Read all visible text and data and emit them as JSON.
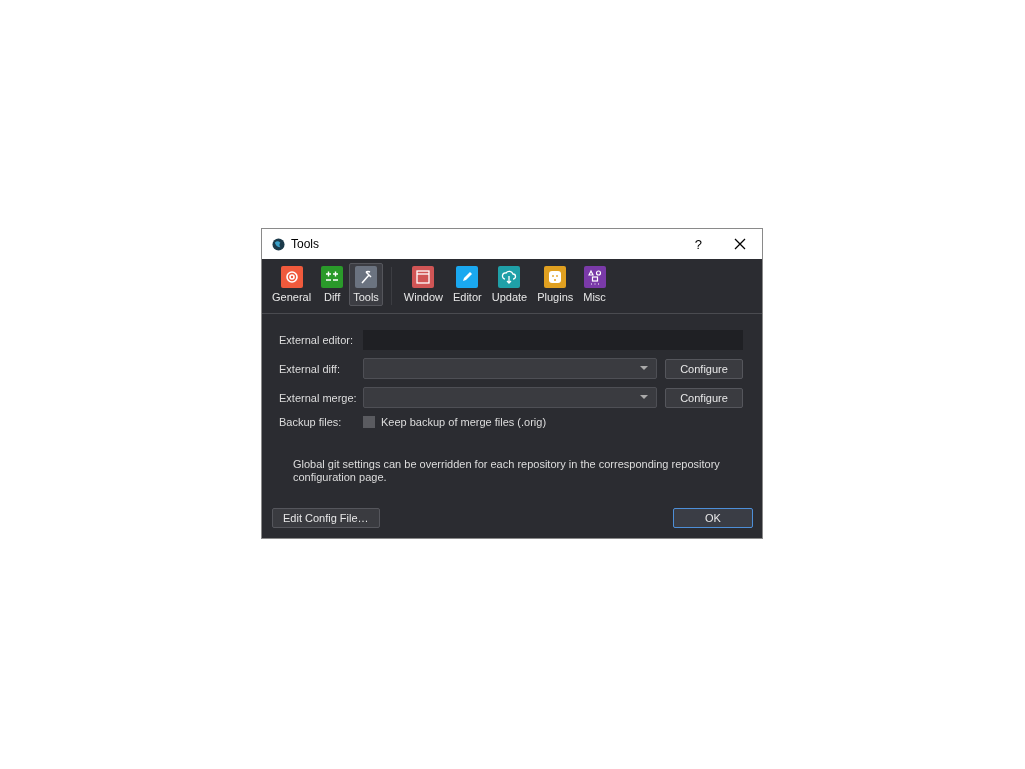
{
  "window": {
    "title": "Tools",
    "help": "?"
  },
  "tabs": [
    {
      "label": "General",
      "kind": "general",
      "color": "#f05a3c",
      "selected": false
    },
    {
      "label": "Diff",
      "kind": "diff",
      "color": "#2a9a2a",
      "selected": false
    },
    {
      "label": "Tools",
      "kind": "tools",
      "color": "#6b7380",
      "selected": true
    },
    {
      "label": "Window",
      "kind": "window",
      "color": "#d05555",
      "selected": false
    },
    {
      "label": "Editor",
      "kind": "editor",
      "color": "#1aa8f0",
      "selected": false
    },
    {
      "label": "Update",
      "kind": "update",
      "color": "#1fa0a8",
      "selected": false
    },
    {
      "label": "Plugins",
      "kind": "plugins",
      "color": "#e0a020",
      "selected": false
    },
    {
      "label": "Misc",
      "kind": "misc",
      "color": "#7a3aa8",
      "selected": false
    }
  ],
  "form": {
    "external_editor": {
      "label": "External editor:"
    },
    "external_diff": {
      "label": "External diff:",
      "button": "Configure"
    },
    "external_merge": {
      "label": "External merge:",
      "button": "Configure"
    },
    "backup": {
      "label": "Backup files:",
      "checkbox": "Keep backup of merge files (.orig)",
      "checked": false
    }
  },
  "note": "Global git settings can be overridden for each repository in the corresponding repository configuration page.",
  "buttons": {
    "edit_config": "Edit Config File…",
    "ok": "OK"
  }
}
